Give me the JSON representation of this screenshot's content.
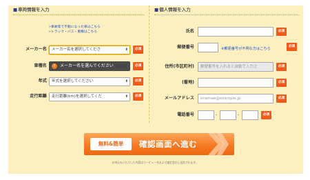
{
  "vehicle": {
    "heading": "車両情報を入力",
    "heading_mark": "■",
    "notes": [
      "»事故等で不動になった車はこちら",
      "»トラック・バス・重機はこちら"
    ],
    "maker": {
      "label": "メーカー名",
      "value": "メーカー名を選択してくださ"
    },
    "model": {
      "label": "車種名",
      "tooltip": "メーカー名を選んでください"
    },
    "year": {
      "label": "年式",
      "value": "年式を選択してください"
    },
    "mileage": {
      "label": "走行距離",
      "value": "走行距離(km)を選択してくだ"
    }
  },
  "personal": {
    "heading": "個人情報を入力",
    "heading_mark": "■",
    "name": {
      "label": "氏名",
      "value": ""
    },
    "postal": {
      "label": "郵便番号",
      "value": "",
      "help": "※郵便番号が不明な方はこちら"
    },
    "address": {
      "label": "住所(市区町村)",
      "placeholder": "郵便番号を入れると自動で入力さ"
    },
    "street": {
      "label": "(番地)",
      "value": ""
    },
    "email": {
      "label": "メールアドレス",
      "placeholder": "onamae@example.jp"
    },
    "phone": {
      "label": "電話番号",
      "separator": "-"
    }
  },
  "required_label": "必須",
  "select_arrow": "⬍",
  "warning_glyph": "!",
  "cta": {
    "badge": "無料&簡単",
    "label": "確認画面へ進む"
  },
  "footer": "お申込みいただいた内容はカーピュー名および査定会社に送信されます。",
  "colors": {
    "panel": "#fdf0c0",
    "accent": "#f25a1c",
    "cta": "#f57a24",
    "link": "#2255cc"
  }
}
